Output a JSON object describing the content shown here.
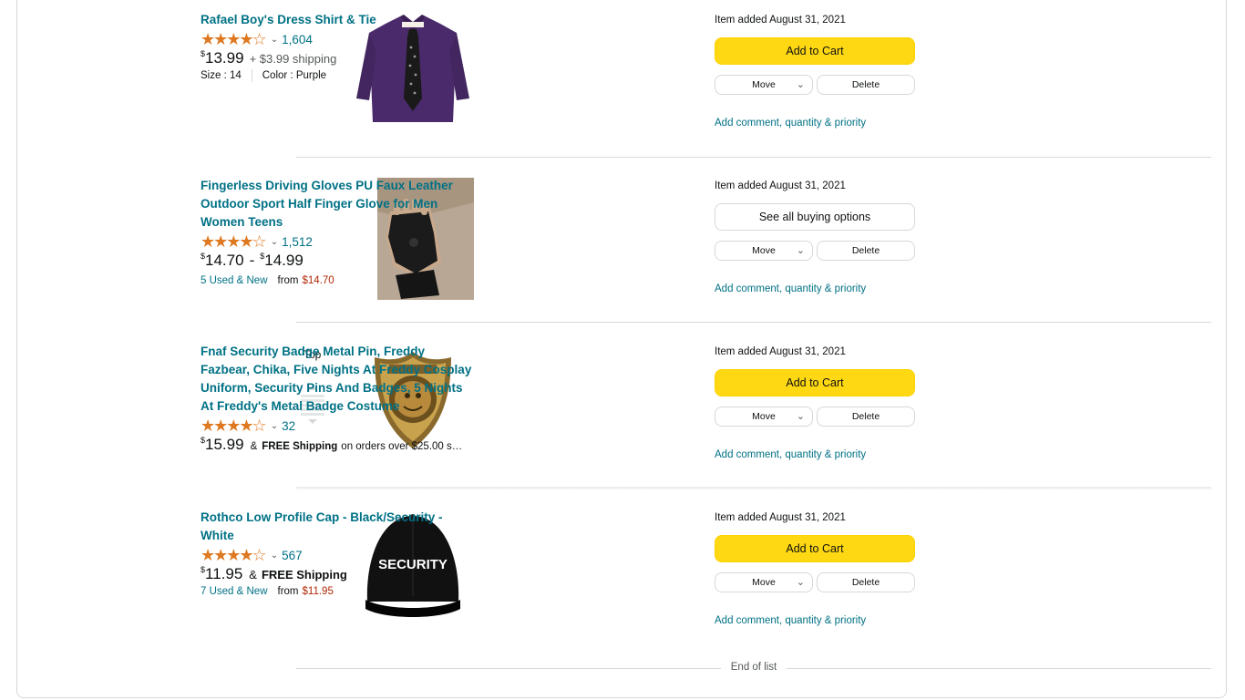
{
  "nav": {
    "top_label": "Top"
  },
  "items": [
    {
      "title": "Rafael Boy's Dress Shirt & Tie",
      "rating_count": "1,604",
      "price_currency": "$",
      "price": "13.99",
      "shipping": "+ $3.99 shipping",
      "size": "Size : 14",
      "color": "Color : Purple",
      "added": "Item added August 31, 2021",
      "primary_button": "Add to Cart",
      "move_label": "Move",
      "delete_label": "Delete",
      "comment_link": "Add comment, quantity & priority"
    },
    {
      "title": "Fingerless Driving Gloves PU Faux Leather Outdoor Sport Half Finger Glove for Men Women Teens",
      "rating_count": "1,512",
      "price_currency": "$",
      "price_low": "14.70",
      "price_sep": "-",
      "price_high": "14.99",
      "used_new": "5 Used & New",
      "from_label": "from",
      "from_price": "$14.70",
      "added": "Item added August 31, 2021",
      "primary_button": "See all buying options",
      "move_label": "Move",
      "delete_label": "Delete",
      "comment_link": "Add comment, quantity & priority"
    },
    {
      "title": "Fnaf Security Badge Metal Pin, Freddy Fazbear, Chika, Five Nights At Freddy Cosplay Uniform, Security Pins And Badges, 5 Nights At Freddy's Metal Badge Costume",
      "rating_count": "32",
      "price_currency": "$",
      "price": "15.99",
      "amp": "&",
      "free_shipping": "FREE Shipping",
      "shipping_note": "on orders over $25.00 s…",
      "added": "Item added August 31, 2021",
      "primary_button": "Add to Cart",
      "move_label": "Move",
      "delete_label": "Delete",
      "comment_link": "Add comment, quantity & priority"
    },
    {
      "title": "Rothco Low Profile Cap - Black/Security - White",
      "rating_count": "567",
      "price_currency": "$",
      "price": "11.95",
      "amp": "&",
      "free_shipping": "FREE Shipping",
      "used_new": "7 Used & New",
      "from_label": "from",
      "from_price": "$11.95",
      "cap_text": "SECURITY",
      "added": "Item added August 31, 2021",
      "primary_button": "Add to Cart",
      "move_label": "Move",
      "delete_label": "Delete",
      "comment_link": "Add comment, quantity & priority"
    }
  ],
  "end_of_list": "End of list",
  "colors": {
    "link": "#007185",
    "star": "#de7921",
    "button_yellow": "#ffd814",
    "price_red": "#b12704"
  }
}
